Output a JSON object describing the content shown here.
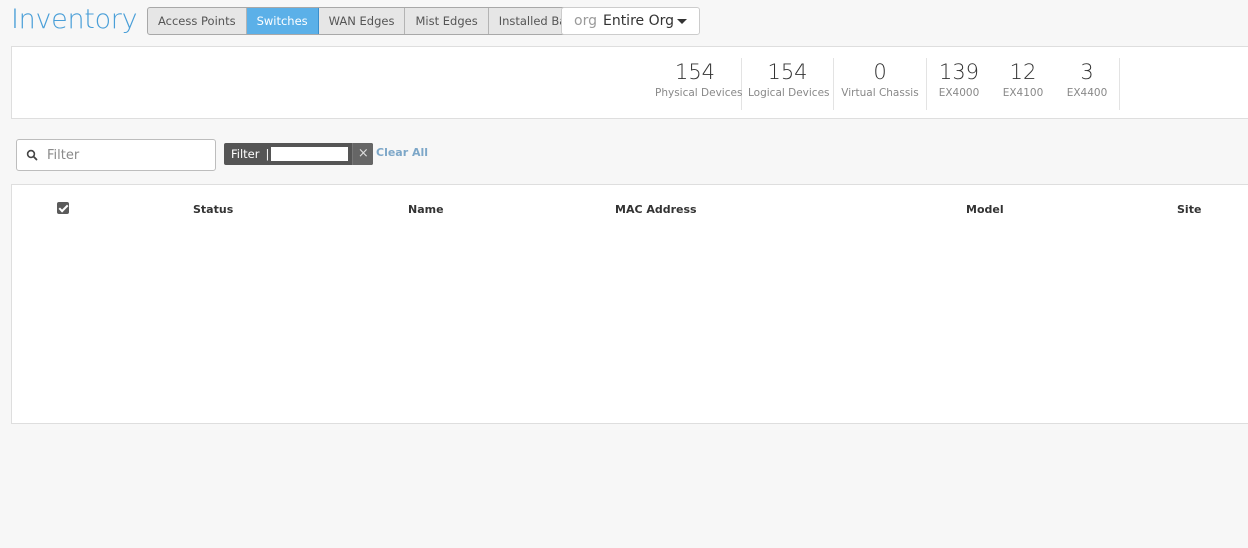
{
  "header": {
    "title": "Inventory",
    "tabs": [
      {
        "label": "Access Points",
        "active": false
      },
      {
        "label": "Switches",
        "active": true
      },
      {
        "label": "WAN Edges",
        "active": false
      },
      {
        "label": "Mist Edges",
        "active": false
      },
      {
        "label": "Installed Base",
        "active": false
      }
    ],
    "org_selector": {
      "prefix": "org",
      "value": "Entire Org"
    }
  },
  "stats": {
    "physical": {
      "value": "154",
      "label": "Physical Devices"
    },
    "logical": {
      "value": "154",
      "label": "Logical Devices"
    },
    "virtual_chassis": {
      "value": "0",
      "label": "Virtual Chassis"
    },
    "models": [
      {
        "value": "139",
        "label": "EX4000"
      },
      {
        "value": "12",
        "label": "EX4100"
      },
      {
        "value": "3",
        "label": "EX4400"
      }
    ]
  },
  "filter": {
    "placeholder": "Filter",
    "chip_label": "Filter",
    "clear_all": "Clear All"
  },
  "table": {
    "columns": [
      "Status",
      "Name",
      "MAC Address",
      "Model",
      "Site"
    ],
    "select_all_checked": true
  },
  "colors": {
    "accent": "#4a9fd8",
    "active_tab": "#5bb0e8",
    "chip": "#555555",
    "link": "#7da7c8"
  }
}
